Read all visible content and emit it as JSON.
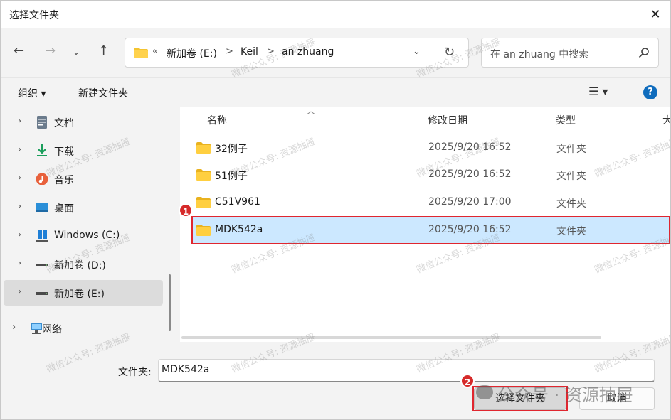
{
  "window": {
    "title": "选择文件夹"
  },
  "address": {
    "overflow": "«",
    "crumbs": [
      "新加卷 (E:)",
      "Keil",
      "an zhuang"
    ],
    "separator": ">"
  },
  "search": {
    "placeholder": "在 an zhuang 中搜索"
  },
  "toolbar": {
    "organize": "组织 ▾",
    "new_folder": "新建文件夹",
    "help": "?"
  },
  "sidebar": {
    "items": [
      {
        "label": "文档",
        "icon": "document-icon"
      },
      {
        "label": "下载",
        "icon": "download-icon"
      },
      {
        "label": "音乐",
        "icon": "music-icon"
      },
      {
        "label": "桌面",
        "icon": "desktop-icon"
      },
      {
        "label": "Windows (C:)",
        "icon": "windows-drive-icon"
      },
      {
        "label": "新加卷 (D:)",
        "icon": "drive-icon"
      },
      {
        "label": "新加卷 (E:)",
        "icon": "drive-icon",
        "selected": true
      },
      {
        "label": "网络",
        "icon": "network-icon"
      }
    ]
  },
  "columns": {
    "name": "名称",
    "modified": "修改日期",
    "type": "类型",
    "size": "大"
  },
  "files": [
    {
      "name": "32例子",
      "modified": "2025/9/20 16:52",
      "type": "文件夹"
    },
    {
      "name": "51例子",
      "modified": "2025/9/20 16:52",
      "type": "文件夹"
    },
    {
      "name": "C51V961",
      "modified": "2025/9/20 17:00",
      "type": "文件夹"
    },
    {
      "name": "MDK542a",
      "modified": "2025/9/20 16:52",
      "type": "文件夹",
      "selected": true
    }
  ],
  "footer": {
    "folder_label": "文件夹:",
    "folder_value": "MDK542a",
    "select_button": "选择文件夹",
    "cancel_button": "取消"
  },
  "annotations": {
    "badge1": "1",
    "badge2": "2"
  },
  "watermark": {
    "text": "微信公众号: 资源抽屉",
    "footer_text": "公众号 · 资源抽屉"
  },
  "colors": {
    "accent": "#0f6cbd",
    "selection": "#cce8ff",
    "highlight": "#e0262f",
    "folder": "#f4c430"
  }
}
